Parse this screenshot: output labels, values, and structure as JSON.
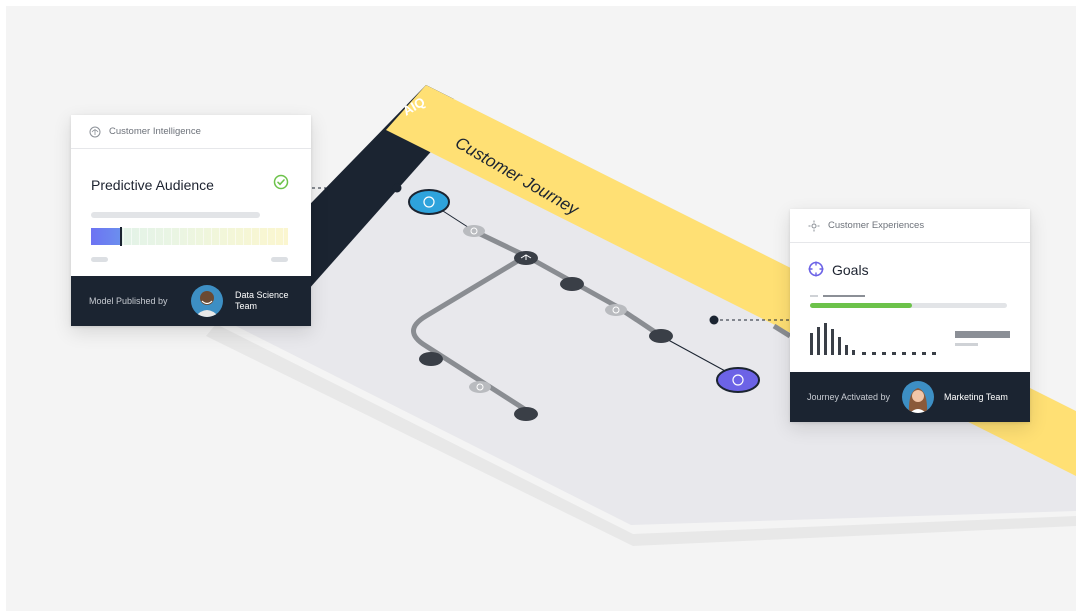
{
  "board": {
    "logo": "AIQ",
    "title": "Customer Journey"
  },
  "card_left": {
    "header": "Customer Intelligence",
    "header_icon": "brain-icon",
    "title": "Predictive Audience",
    "status_icon": "check-circle-icon",
    "status_color": "#6cc24a",
    "footer_label": "Model Published by",
    "footer_team": "Data Science Team"
  },
  "card_right": {
    "header": "Customer Experiences",
    "header_icon": "settings-target-icon",
    "title": "Goals",
    "title_icon": "target-icon",
    "progress_fraction": 0.52,
    "progress_color": "#6cc24a",
    "footer_label": "Journey Activated by",
    "footer_team": "Marketing Team"
  },
  "colors": {
    "navy": "#1b2431",
    "yellow": "#ffe074",
    "start_node": "#2ea3dc",
    "end_node": "#6c63e6",
    "step_node": "#3a3f47"
  }
}
